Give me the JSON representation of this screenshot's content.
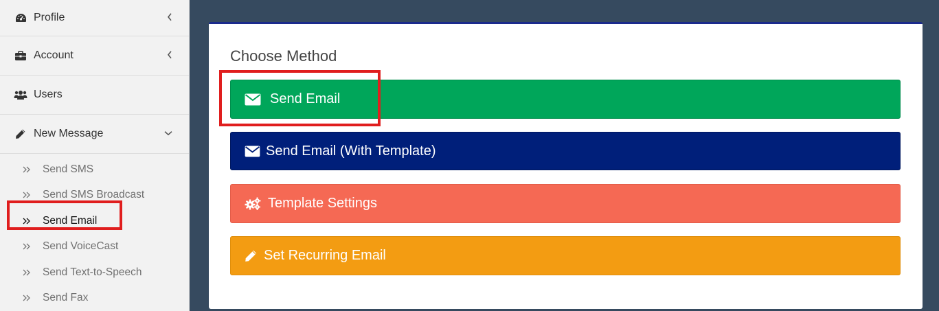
{
  "sidebar": {
    "items": [
      {
        "label": "Profile",
        "icon": "dashboard-icon",
        "chevron": "chevron-left-icon"
      },
      {
        "label": "Account",
        "icon": "briefcase-icon",
        "chevron": "chevron-left-icon"
      },
      {
        "label": "Users",
        "icon": "users-icon"
      },
      {
        "label": "New Message",
        "icon": "pencil-icon",
        "chevron": "chevron-down-icon"
      }
    ],
    "submenu": [
      {
        "label": "Send SMS"
      },
      {
        "label": "Send SMS Broadcast"
      },
      {
        "label": "Send Email",
        "active": true
      },
      {
        "label": "Send VoiceCast"
      },
      {
        "label": "Send Text-to-Speech"
      },
      {
        "label": "Send Fax"
      }
    ]
  },
  "main": {
    "title": "Choose Method",
    "buttons": [
      {
        "label": "Send Email",
        "icon": "envelope-icon",
        "color": "#00a65a"
      },
      {
        "label": "Send Email (With Template)",
        "icon": "envelope-icon",
        "color": "#001f7a"
      },
      {
        "label": "Template Settings",
        "icon": "gears-icon",
        "color": "#f56954"
      },
      {
        "label": "Set Recurring Email",
        "icon": "pencil-icon",
        "color": "#f39c12"
      }
    ]
  },
  "colors": {
    "background": "#364a5f",
    "sidebar": "#f2f2f2",
    "highlight": "#e01e1e",
    "panel_border": "#1b2a8c"
  }
}
